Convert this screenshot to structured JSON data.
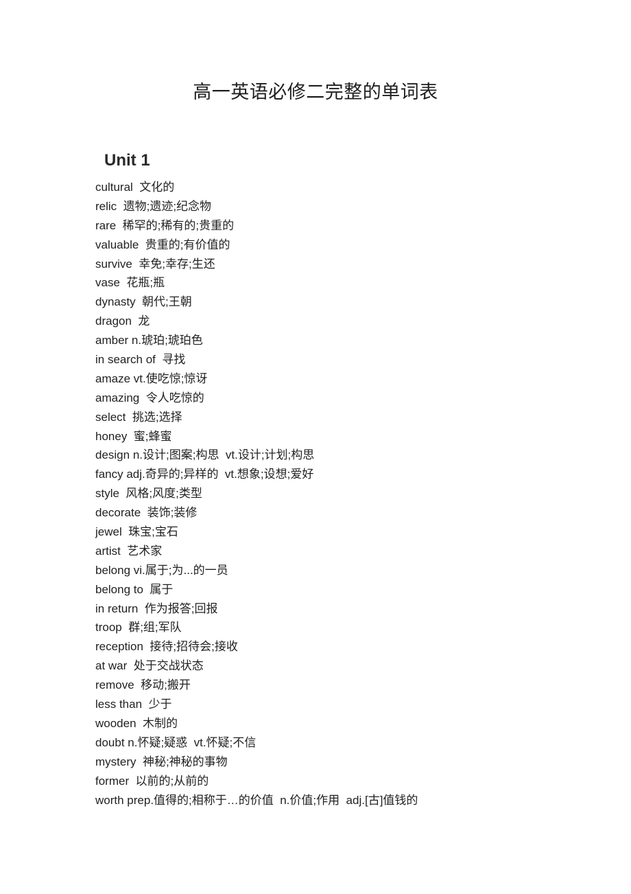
{
  "document": {
    "title": "高一英语必修二完整的单词表",
    "unit_heading": "Unit 1",
    "entries": [
      {
        "text": "cultural  文化的"
      },
      {
        "text": "relic  遗物;遗迹;纪念物"
      },
      {
        "text": "rare  稀罕的;稀有的;贵重的"
      },
      {
        "text": "valuable  贵重的;有价值的"
      },
      {
        "text": "survive  幸免;幸存;生还"
      },
      {
        "text": "vase  花瓶;瓶"
      },
      {
        "text": "dynasty  朝代;王朝"
      },
      {
        "text": "dragon  龙"
      },
      {
        "text": "amber n.琥珀;琥珀色"
      },
      {
        "text": "in search of  寻找"
      },
      {
        "text": "amaze vt.使吃惊;惊讶"
      },
      {
        "text": "amazing  令人吃惊的"
      },
      {
        "text": "select  挑选;选择"
      },
      {
        "text": "honey  蜜;蜂蜜"
      },
      {
        "text": "design n.设计;图案;构思  vt.设计;计划;构思"
      },
      {
        "text": "fancy adj.奇异的;异样的  vt.想象;设想;爱好"
      },
      {
        "text": "style  风格;风度;类型"
      },
      {
        "text": "decorate  装饰;装修"
      },
      {
        "text": "jewel  珠宝;宝石"
      },
      {
        "text": "artist  艺术家"
      },
      {
        "text": "belong vi.属于;为...的一员"
      },
      {
        "text": "belong to  属于"
      },
      {
        "text": "in return  作为报答;回报"
      },
      {
        "text": "troop  群;组;军队"
      },
      {
        "text": "reception  接待;招待会;接收"
      },
      {
        "text": "at war  处于交战状态"
      },
      {
        "text": "remove  移动;搬开"
      },
      {
        "text": "less than  少于"
      },
      {
        "text": "wooden  木制的"
      },
      {
        "text": "doubt n.怀疑;疑惑  vt.怀疑;不信"
      },
      {
        "text": "mystery  神秘;神秘的事物"
      },
      {
        "text": "former  以前的;从前的"
      },
      {
        "text": "worth prep.值得的;相称于…的价值  n.价值;作用  adj.[古]值钱的"
      }
    ]
  }
}
